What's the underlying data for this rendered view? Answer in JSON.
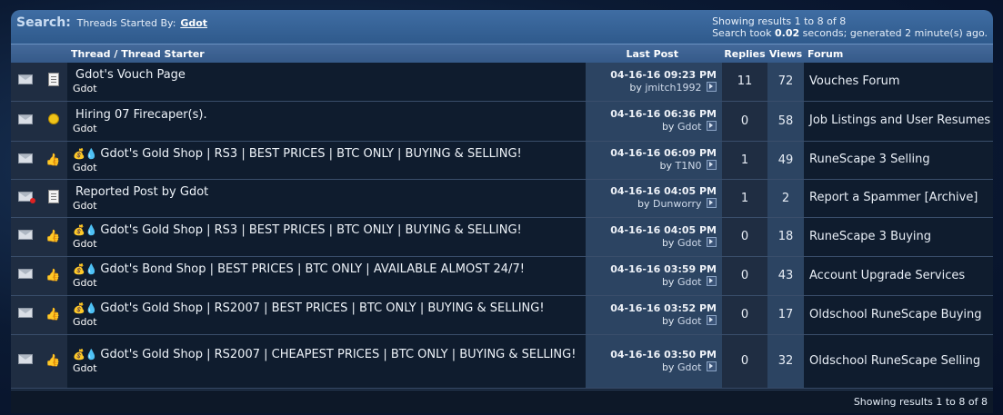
{
  "search": {
    "label": "Search:",
    "subtitle": "Threads Started By:",
    "user": "Gdot",
    "results": "Showing results 1 to 8 of 8",
    "timing_prefix": "Search took",
    "timing_value": "0.02",
    "timing_suffix": "seconds; generated 2 minute(s) ago."
  },
  "columns": {
    "thread": "Thread / Thread Starter",
    "last_post": "Last Post",
    "replies": "Replies",
    "views": "Views",
    "forum": "Forum"
  },
  "rows": [
    {
      "status_icon": "envelope-icon",
      "thread_icon": "document-icon",
      "prefix": "",
      "title": "Gdot's Vouch Page",
      "starter": "Gdot",
      "date": "04-16-16 09:23 PM",
      "by": "by",
      "last_user": "jmitch1992",
      "replies": "11",
      "views": "72",
      "forum": "Vouches Forum"
    },
    {
      "status_icon": "envelope-icon",
      "thread_icon": "lightbulb-icon",
      "prefix": "",
      "title": "Hiring 07 Firecaper(s).",
      "starter": "Gdot",
      "date": "04-16-16 06:36 PM",
      "by": "by",
      "last_user": "Gdot",
      "replies": "0",
      "views": "58",
      "forum": "Job Listings and User Resumes"
    },
    {
      "status_icon": "envelope-icon",
      "thread_icon": "thumbs-up-icon",
      "prefix": "💰💧",
      "title": "Gdot's Gold Shop | RS3 | BEST PRICES | BTC ONLY | BUYING & SELLING!",
      "starter": "Gdot",
      "date": "04-16-16 06:09 PM",
      "by": "by",
      "last_user": "T1N0",
      "replies": "1",
      "views": "49",
      "forum": "RuneScape 3 Selling"
    },
    {
      "status_icon": "envelope-deleted-icon",
      "thread_icon": "document-icon",
      "prefix": "",
      "title": "Reported Post by Gdot",
      "starter": "Gdot",
      "date": "04-16-16 04:05 PM",
      "by": "by",
      "last_user": "Dunworry",
      "replies": "1",
      "views": "2",
      "forum": "Report a Spammer [Archive]"
    },
    {
      "status_icon": "envelope-icon",
      "thread_icon": "thumbs-up-icon",
      "prefix": "💰💧",
      "title": "Gdot's Gold Shop | RS3 | BEST PRICES | BTC ONLY | BUYING & SELLING!",
      "starter": "Gdot",
      "date": "04-16-16 04:05 PM",
      "by": "by",
      "last_user": "Gdot",
      "replies": "0",
      "views": "18",
      "forum": "RuneScape 3 Buying"
    },
    {
      "status_icon": "envelope-icon",
      "thread_icon": "thumbs-up-icon",
      "prefix": "💰💧",
      "title": "Gdot's Bond Shop | BEST PRICES | BTC ONLY | AVAILABLE ALMOST 24/7!",
      "starter": "Gdot",
      "date": "04-16-16 03:59 PM",
      "by": "by",
      "last_user": "Gdot",
      "replies": "0",
      "views": "43",
      "forum": "Account Upgrade Services"
    },
    {
      "status_icon": "envelope-icon",
      "thread_icon": "thumbs-up-icon",
      "prefix": "💰💧",
      "title": "Gdot's Gold Shop | RS2007 | BEST PRICES | BTC ONLY | BUYING & SELLING!",
      "starter": "Gdot",
      "date": "04-16-16 03:52 PM",
      "by": "by",
      "last_user": "Gdot",
      "replies": "0",
      "views": "17",
      "forum": "Oldschool RuneScape Buying"
    },
    {
      "status_icon": "envelope-icon",
      "thread_icon": "thumbs-up-icon",
      "prefix": "💰💧",
      "title": "Gdot's Gold Shop | RS2007 | CHEAPEST PRICES | BTC ONLY | BUYING & SELLING!",
      "starter": "Gdot",
      "date": "04-16-16 03:50 PM",
      "by": "by",
      "last_user": "Gdot",
      "replies": "0",
      "views": "32",
      "forum": "Oldschool RuneScape Selling"
    }
  ],
  "footer": {
    "results": "Showing results 1 to 8 of 8"
  }
}
